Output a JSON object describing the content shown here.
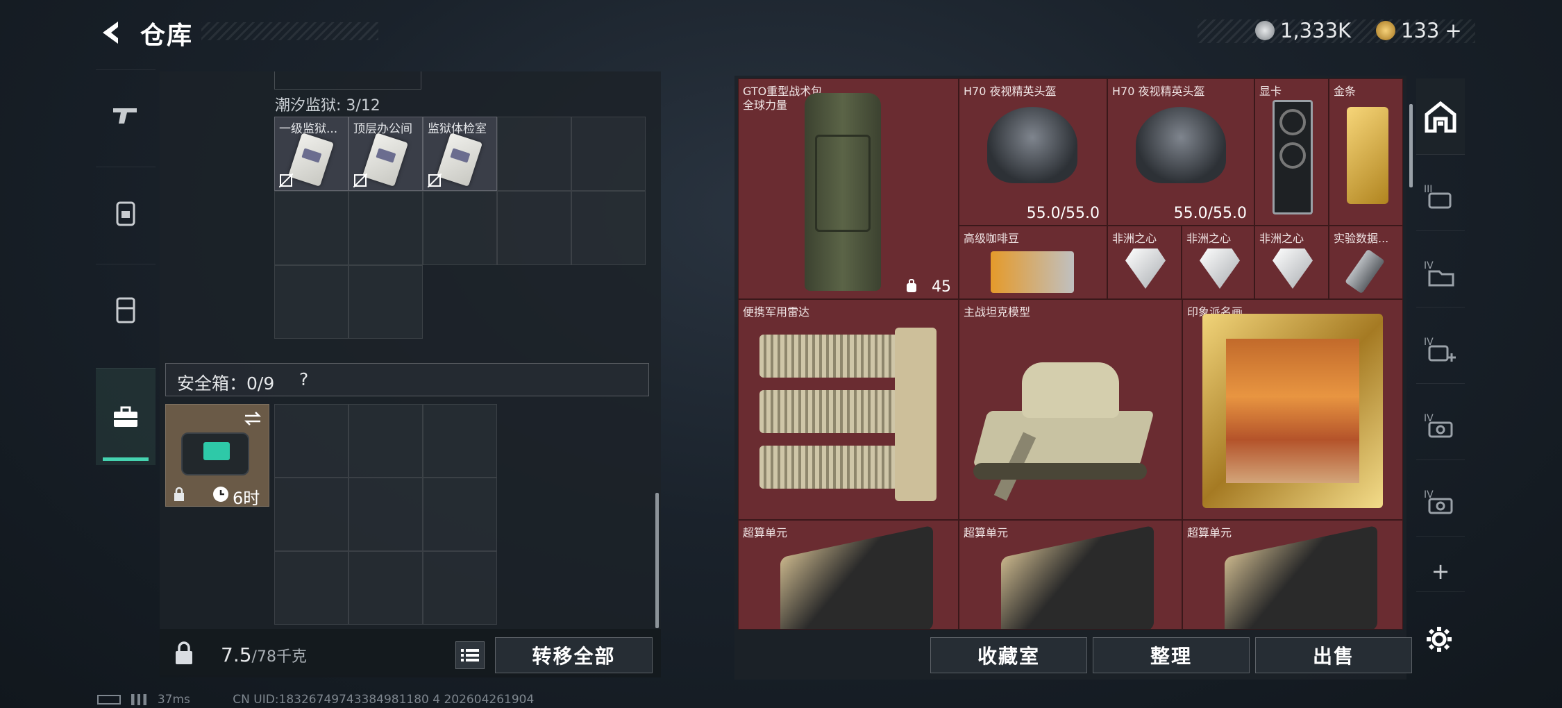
{
  "header": {
    "title": "仓库"
  },
  "currency": {
    "coins": "1,333K",
    "gems": "133",
    "gems_add": "+"
  },
  "left_nav": [
    "pistol-icon",
    "backpack-icon",
    "vest-icon",
    "briefcase-icon"
  ],
  "container": {
    "section_label": "潮汐监狱: 3/12",
    "items": [
      {
        "label": "一级监狱..."
      },
      {
        "label": "顶层办公间"
      },
      {
        "label": "监狱体检室"
      }
    ]
  },
  "safe": {
    "label": "安全箱：0/9",
    "help": "?",
    "timer": "6时"
  },
  "bottom_left": {
    "weight": "7.5",
    "weight_max": "/78千克",
    "transfer_all": "转移全部"
  },
  "stash_items": [
    {
      "label": "GTO重型战术包",
      "sub": "全球力量",
      "value": "45"
    },
    {
      "label": "H70 夜视精英头盔",
      "value": "55.0/55.0"
    },
    {
      "label": "H70 夜视精英头盔",
      "value": "55.0/55.0"
    },
    {
      "label": "显卡"
    },
    {
      "label": "金条"
    },
    {
      "label": "高级咖啡豆"
    },
    {
      "label": "非洲之心"
    },
    {
      "label": "非洲之心"
    },
    {
      "label": "非洲之心"
    },
    {
      "label": "实验数据..."
    },
    {
      "label": "便携军用雷达"
    },
    {
      "label": "主战坦克模型"
    },
    {
      "label": "印象派名画"
    },
    {
      "label": "超算单元"
    },
    {
      "label": "超算单元"
    },
    {
      "label": "超算单元"
    }
  ],
  "side_tabs": {
    "add": "+"
  },
  "bottom_right": {
    "collection": "收藏室",
    "organize": "整理",
    "sell": "出售"
  },
  "footer": {
    "ping": "37ms",
    "uid": "CN UID:18326749743384981180 4  202604261904"
  },
  "colors": {
    "accent": "#45d3b0",
    "stash_bg": "#6a2c31"
  }
}
